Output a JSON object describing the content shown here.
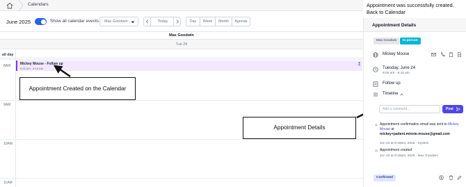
{
  "breadcrumb": {
    "home_icon": "home-icon",
    "label": "Calendars"
  },
  "toolbar": {
    "month_label": "June 2025",
    "toggle_label": "Show all calendar events",
    "toggle_on": true,
    "provider_select_value": "Max Goodwin",
    "nav_today": "Today",
    "views": [
      "Day",
      "Week",
      "Month",
      "Agenda"
    ]
  },
  "calendar": {
    "provider_column": "Max Goodwin",
    "day_label": "Tue 24",
    "allday_label": "all day",
    "hours": [
      "8AM",
      "9AM",
      "10AM",
      "11AM"
    ],
    "event": {
      "title": "Mickey Mouse - Follow up",
      "time": "8:00 AM - 8:15 AM",
      "color": "#7c3aed",
      "bg_color": "#f3e8ff"
    }
  },
  "annotations": {
    "calendar_callout": "Appointment Created on the Calendar",
    "details_callout": "Appointment Details"
  },
  "success_message": {
    "line1": "Appointment was successfully created.",
    "line2": "Back to Calendar"
  },
  "panel": {
    "title": "Appointment Details",
    "provider_badge": "Max Goodwin",
    "visit_badge": "In person",
    "patient_name": "Mickey Mouse",
    "date": "Tuesday, June 24",
    "time": "8:00 am - 8:15 am",
    "reason": "Follow up",
    "timeline_label": "Timeline",
    "comment_placeholder": "Add a comment...",
    "post_label": "Post",
    "timeline": [
      {
        "text_prefix": "Appointment confirmation email was sent to ",
        "link": "Mickey Mouse",
        "text_mid": " at",
        "email": "mickey+patient.minnie.mouse@gmail.com",
        "meta": "Jun 23 at 9:19am, 2025 - System"
      },
      {
        "text": "Appointment created",
        "meta": "Jun 23 at 9:19am, 2025 - Max Goodwin"
      }
    ],
    "status": "Confirmed",
    "accent_color": "#4f46e5",
    "visit_badge_color": "#06b6d4"
  }
}
